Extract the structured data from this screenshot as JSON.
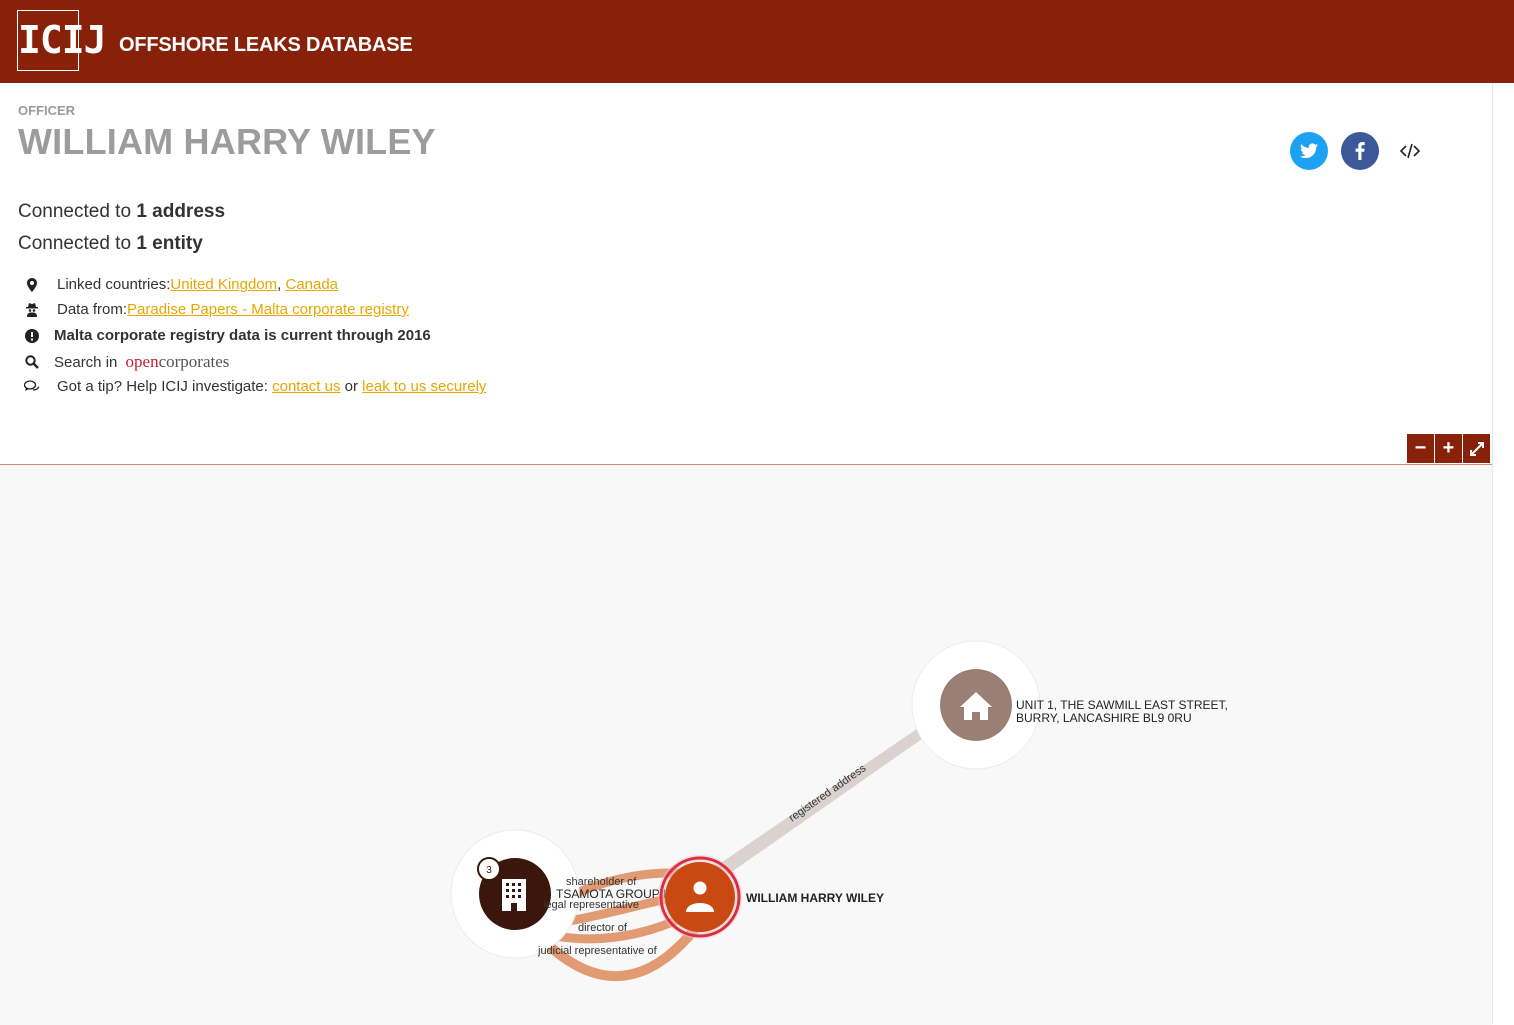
{
  "header": {
    "logo_text": "ICIJ",
    "site_title": "OFFSHORE LEAKS DATABASE",
    "background_color": "#872109"
  },
  "officer": {
    "kind": "OFFICER",
    "name": "WILLIAM HARRY WILEY"
  },
  "share": {
    "twitter_icon": "twitter-icon",
    "facebook_icon": "facebook-icon",
    "embed_icon": "code-icon"
  },
  "connections": {
    "addresses_prefix": "Connected to ",
    "addresses_value": "1 address",
    "entities_prefix": "Connected to ",
    "entities_value": "1 entity"
  },
  "info": {
    "countries_label": "Linked countries: ",
    "countries": [
      "United Kingdom",
      "Canada"
    ],
    "countries_sep": ", ",
    "data_from_label": "Data from: ",
    "data_from_link": "Paradise Papers - Malta corporate registry",
    "notice": "Malta corporate registry data is current through 2016",
    "search_label": "Search in ",
    "opencorporates_open": "open",
    "opencorporates_corporates": "corporates",
    "tip_label": "Got a tip? Help ICIJ investigate: ",
    "tip_contact": "contact us",
    "tip_or": " or ",
    "tip_leak": "leak to us securely",
    "link_color": "#e6a800"
  },
  "graph_controls": {
    "zoom_out": "−",
    "zoom_in": "+",
    "fullscreen_icon": "expand-icon"
  },
  "graph": {
    "nodes": {
      "address": {
        "label_line1": "UNIT 1, THE SAWMILL EAST STREET,",
        "label_line2": "BURRY, LANCASHIRE BL9 0RU",
        "icon": "home-icon",
        "color": "#9a8074"
      },
      "officer": {
        "label": "WILLIAM HARRY WILEY",
        "icon": "person-icon",
        "color": "#c84a12"
      },
      "entity": {
        "label": "TSAMOTA GROUP LTD",
        "icon": "building-icon",
        "badge": "3",
        "color": "#3b160c"
      }
    },
    "edges": {
      "registered_address": "registered address",
      "shareholder_of": "shareholder of",
      "legal_representative": "legal representative",
      "director_of": "director of",
      "judicial_representative_of": "judicial representative of"
    }
  }
}
